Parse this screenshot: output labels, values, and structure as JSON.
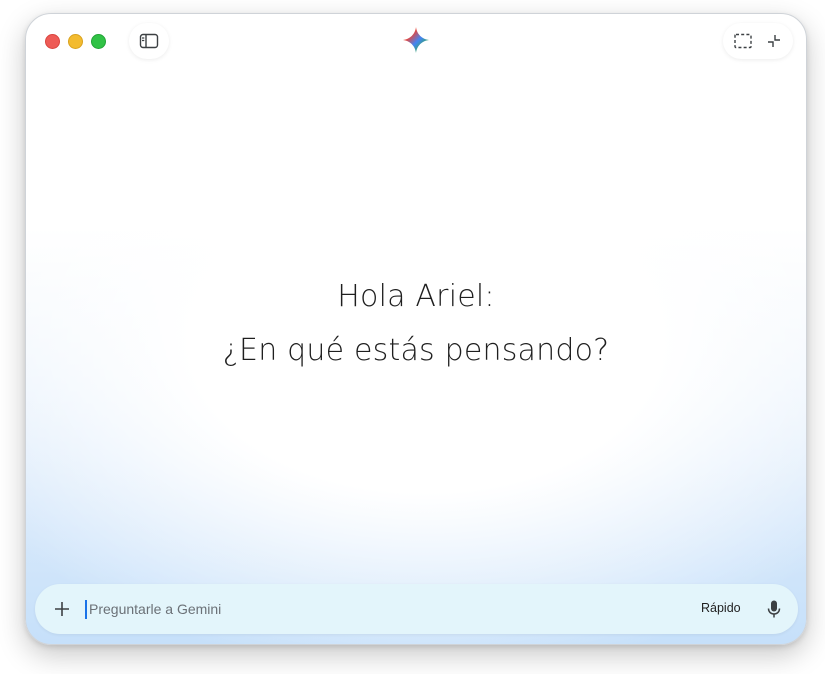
{
  "window": {
    "traffic_lights": [
      "close",
      "minimize",
      "zoom"
    ]
  },
  "toolbar": {
    "sidebar_icon": "sidebar-toggle-icon",
    "logo_icon": "gemini-sparkle-icon",
    "right_icons": [
      "screenshot-select-icon",
      "collapse-icon"
    ]
  },
  "greeting": {
    "line1": "Hola Ariel:",
    "line2": "¿En qué estás pensando?"
  },
  "prompt": {
    "placeholder": "Preguntarle a Gemini",
    "value": "",
    "mode_label": "Rápido",
    "add_icon": "plus-icon",
    "mic_icon": "microphone-icon"
  },
  "colors": {
    "close": "#ee5b56",
    "minimize": "#f3bb2f",
    "zoom": "#31c246",
    "input_bg": "#e3f5fb",
    "caret": "#1a73e8"
  }
}
